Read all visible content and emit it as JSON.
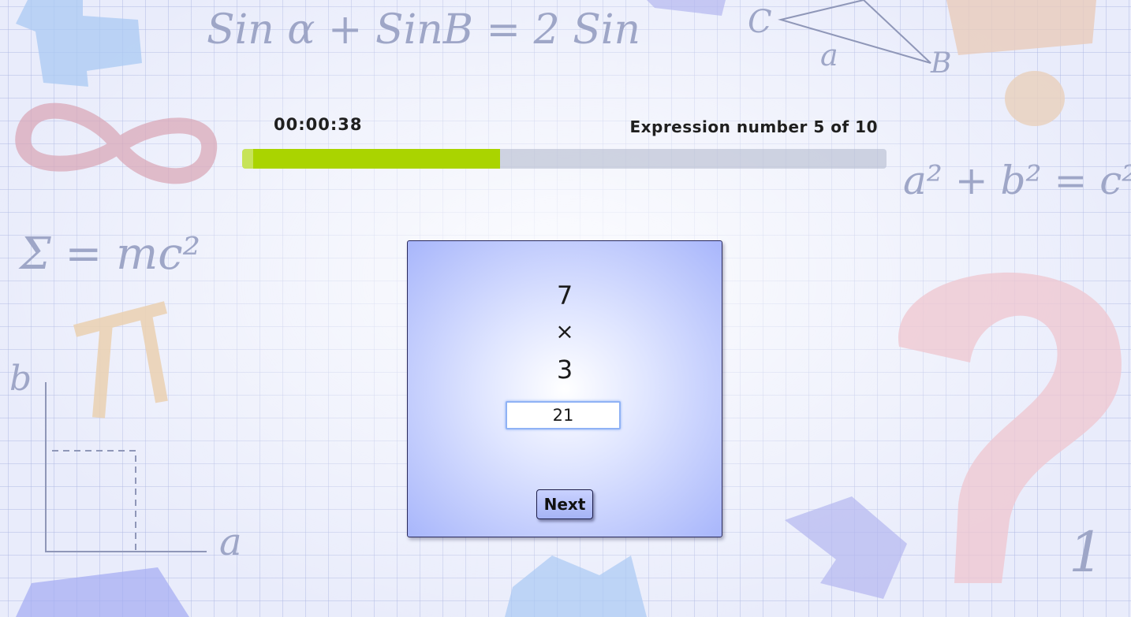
{
  "hud": {
    "timer": "00:00:38",
    "counter_text": "Expression number 5 of 10",
    "progress_fraction": 0.4
  },
  "expression": {
    "operand_a": "7",
    "operator": "×",
    "operand_b": "3"
  },
  "answer_input": {
    "value": "21"
  },
  "buttons": {
    "next_label": "Next"
  },
  "background": {
    "formulas": [
      "Sin α + SinB = 2 Sin",
      "a² + b² = c²",
      "Σ = mc²",
      "π",
      "b",
      "a",
      "C",
      "a",
      "B",
      "1"
    ]
  },
  "colors": {
    "progress_fill": "#aad400",
    "card_edge": "#a8b6fb",
    "input_border": "#8fb2f5"
  }
}
